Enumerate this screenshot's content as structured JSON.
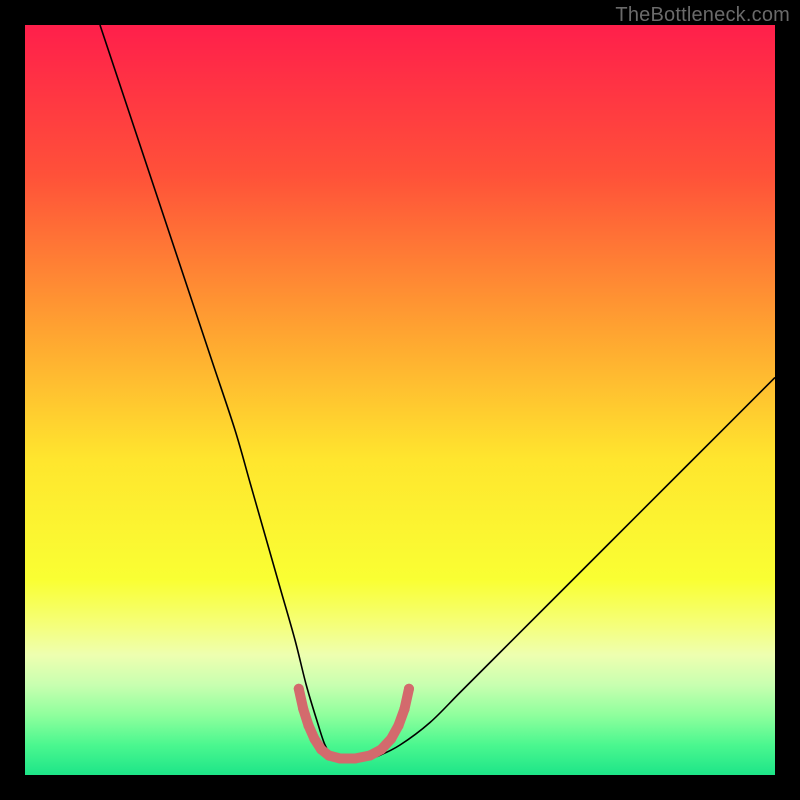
{
  "watermark": {
    "text": "TheBottleneck.com"
  },
  "chart_data": {
    "type": "line",
    "title": "",
    "xlabel": "",
    "ylabel": "",
    "xlim": [
      0,
      100
    ],
    "ylim": [
      0,
      100
    ],
    "grid": false,
    "legend": false,
    "background_gradient": {
      "stops": [
        {
          "pct": 0,
          "color": "#ff1f4b"
        },
        {
          "pct": 20,
          "color": "#ff5139"
        },
        {
          "pct": 40,
          "color": "#ffa031"
        },
        {
          "pct": 58,
          "color": "#ffe62e"
        },
        {
          "pct": 74,
          "color": "#f9ff33"
        },
        {
          "pct": 80,
          "color": "#f5ff7a"
        },
        {
          "pct": 84,
          "color": "#eeffb0"
        },
        {
          "pct": 88,
          "color": "#c8ffb0"
        },
        {
          "pct": 92,
          "color": "#8fff9d"
        },
        {
          "pct": 96,
          "color": "#4bf78f"
        },
        {
          "pct": 100,
          "color": "#1de588"
        }
      ]
    },
    "series": [
      {
        "name": "bottleneck-curve",
        "color": "#000000",
        "width": 1.6,
        "x": [
          10,
          13,
          16,
          19,
          22,
          25,
          28,
          30,
          32,
          34,
          36,
          37.5,
          39,
          40,
          41,
          42,
          43,
          45,
          47,
          50,
          54,
          58,
          63,
          70,
          78,
          88,
          100
        ],
        "y": [
          100,
          91,
          82,
          73,
          64,
          55,
          46,
          39,
          32,
          25,
          18,
          12,
          7,
          4,
          2.5,
          2,
          2,
          2,
          2.5,
          4,
          7,
          11,
          16,
          23,
          31,
          41,
          53
        ]
      },
      {
        "name": "trough-marker",
        "color": "#d36a6d",
        "width": 10,
        "linecap": "round",
        "x": [
          36.5,
          37.1,
          37.8,
          38.6,
          39.5,
          40.5,
          42.0,
          44.0,
          46.0,
          47.5,
          48.8,
          49.8,
          50.6,
          51.2
        ],
        "y": [
          11.5,
          8.8,
          6.6,
          4.8,
          3.4,
          2.6,
          2.2,
          2.2,
          2.6,
          3.4,
          4.8,
          6.6,
          8.8,
          11.5
        ]
      }
    ]
  }
}
